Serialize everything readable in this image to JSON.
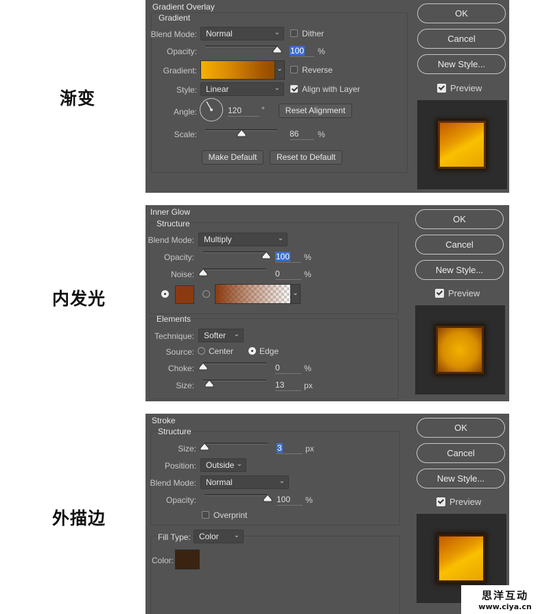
{
  "labels": {
    "gradient": "渐变",
    "inner_glow": "内发光",
    "stroke": "外描边"
  },
  "gradient_overlay": {
    "title": "Gradient Overlay",
    "group": "Gradient",
    "blend_mode_label": "Blend Mode:",
    "blend_mode": "Normal",
    "dither_label": "Dither",
    "opacity_label": "Opacity:",
    "opacity": "100",
    "opacity_unit": "%",
    "gradient_label": "Gradient:",
    "reverse_label": "Reverse",
    "style_label": "Style:",
    "style": "Linear",
    "align_label": "Align with Layer",
    "angle_label": "Angle:",
    "angle": "120",
    "angle_unit": "°",
    "reset_alignment": "Reset Alignment",
    "scale_label": "Scale:",
    "scale": "86",
    "scale_unit": "%",
    "make_default": "Make Default",
    "reset_default": "Reset to Default",
    "ok": "OK",
    "cancel": "Cancel",
    "new_style": "New Style...",
    "preview": "Preview",
    "opacity_level": 1.0,
    "scale_level": 0.5
  },
  "inner_glow": {
    "title": "Inner Glow",
    "group": "Structure",
    "blend_mode_label": "Blend Mode:",
    "blend_mode": "Multiply",
    "opacity_label": "Opacity:",
    "opacity": "100",
    "opacity_unit": "%",
    "noise_label": "Noise:",
    "noise": "0",
    "noise_unit": "%",
    "glow_color": "#8a3a10",
    "elements_group": "Elements",
    "technique_label": "Technique:",
    "technique": "Softer",
    "source_label": "Source:",
    "center_label": "Center",
    "edge_label": "Edge",
    "choke_label": "Choke:",
    "choke": "0",
    "choke_unit": "%",
    "size_label": "Size:",
    "size": "13",
    "size_unit": "px",
    "ok": "OK",
    "cancel": "Cancel",
    "new_style": "New Style...",
    "preview": "Preview",
    "opacity_level": 1.0,
    "noise_level": 0.0,
    "choke_level": 0.0,
    "size_level": 0.1
  },
  "stroke": {
    "title": "Stroke",
    "group": "Structure",
    "size_label": "Size:",
    "size": "3",
    "size_unit": "px",
    "position_label": "Position:",
    "position": "Outside",
    "blend_mode_label": "Blend Mode:",
    "blend_mode": "Normal",
    "opacity_label": "Opacity:",
    "opacity": "100",
    "opacity_unit": "%",
    "overprint_label": "Overprint",
    "fill_type_label": "Fill Type:",
    "fill_type": "Color",
    "color_label": "Color:",
    "color": "#3a2310",
    "ok": "OK",
    "cancel": "Cancel",
    "new_style": "New Style...",
    "preview": "Preview",
    "size_level": 0.0,
    "opacity_level": 1.0
  },
  "watermark": {
    "line1": "思洋互动",
    "line2": "www.ciya.cn"
  }
}
